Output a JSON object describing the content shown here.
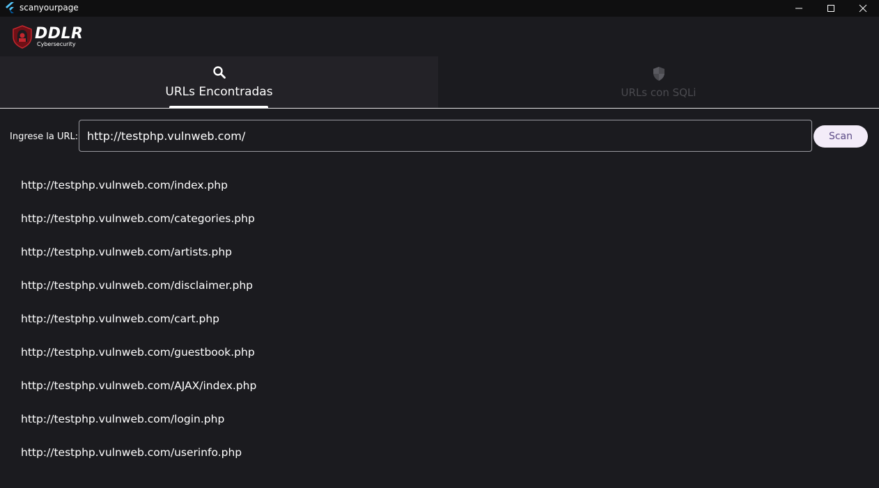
{
  "window": {
    "title": "scanyourpage"
  },
  "logo": {
    "title": "DDLR",
    "subtitle": "Cybersecurity"
  },
  "tabs": [
    {
      "label": "URLs Encontradas",
      "icon": "search-icon",
      "selected": true
    },
    {
      "label": "URLs con SQLi",
      "icon": "shield-icon",
      "selected": false
    }
  ],
  "form": {
    "label": "Ingrese la URL:",
    "value": "http://testphp.vulnweb.com/",
    "button": "Scan"
  },
  "results": [
    "http://testphp.vulnweb.com/index.php",
    "http://testphp.vulnweb.com/categories.php",
    "http://testphp.vulnweb.com/artists.php",
    "http://testphp.vulnweb.com/disclaimer.php",
    "http://testphp.vulnweb.com/cart.php",
    "http://testphp.vulnweb.com/guestbook.php",
    "http://testphp.vulnweb.com/AJAX/index.php",
    "http://testphp.vulnweb.com/login.php",
    "http://testphp.vulnweb.com/userinfo.php"
  ],
  "colors": {
    "background": "#1b1b1f",
    "selected_tab": "#232227",
    "button_bg": "#f3ecf8",
    "button_text": "#5b4a86",
    "logo_red": "#c4262e"
  }
}
